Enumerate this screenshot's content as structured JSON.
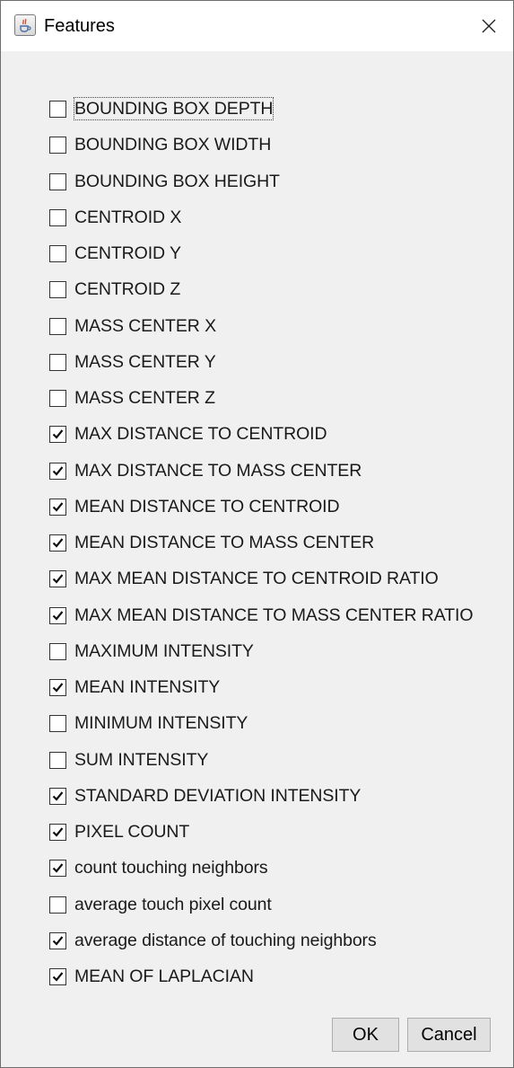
{
  "window": {
    "title": "Features",
    "icon": "java-cup-icon",
    "close_icon": "close-icon"
  },
  "features": [
    {
      "label": "BOUNDING BOX DEPTH",
      "checked": false,
      "focused": true
    },
    {
      "label": "BOUNDING BOX WIDTH",
      "checked": false
    },
    {
      "label": "BOUNDING BOX HEIGHT",
      "checked": false
    },
    {
      "label": "CENTROID X",
      "checked": false
    },
    {
      "label": "CENTROID Y",
      "checked": false
    },
    {
      "label": "CENTROID Z",
      "checked": false
    },
    {
      "label": "MASS CENTER X",
      "checked": false
    },
    {
      "label": "MASS CENTER Y",
      "checked": false
    },
    {
      "label": "MASS CENTER Z",
      "checked": false
    },
    {
      "label": "MAX DISTANCE TO CENTROID",
      "checked": true
    },
    {
      "label": "MAX DISTANCE TO MASS CENTER",
      "checked": true
    },
    {
      "label": "MEAN DISTANCE TO CENTROID",
      "checked": true
    },
    {
      "label": "MEAN DISTANCE TO MASS CENTER",
      "checked": true
    },
    {
      "label": "MAX MEAN DISTANCE TO CENTROID RATIO",
      "checked": true
    },
    {
      "label": "MAX MEAN DISTANCE TO MASS CENTER RATIO",
      "checked": true
    },
    {
      "label": "MAXIMUM INTENSITY",
      "checked": false
    },
    {
      "label": "MEAN INTENSITY",
      "checked": true
    },
    {
      "label": "MINIMUM INTENSITY",
      "checked": false
    },
    {
      "label": "SUM INTENSITY",
      "checked": false
    },
    {
      "label": "STANDARD DEVIATION INTENSITY",
      "checked": true
    },
    {
      "label": "PIXEL COUNT",
      "checked": true
    },
    {
      "label": "count touching neighbors",
      "checked": true
    },
    {
      "label": "average touch pixel count",
      "checked": false
    },
    {
      "label": "average distance of touching neighbors",
      "checked": true
    },
    {
      "label": "MEAN OF LAPLACIAN",
      "checked": true
    }
  ],
  "buttons": {
    "ok_label": "OK",
    "cancel_label": "Cancel"
  }
}
